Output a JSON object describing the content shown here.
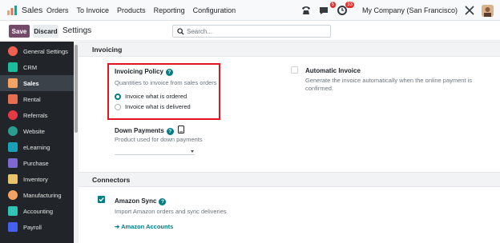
{
  "navbar": {
    "brand": "Sales",
    "menu": [
      "Orders",
      "To Invoice",
      "Products",
      "Reporting",
      "Configuration"
    ],
    "messages_badge": "5",
    "activity_badge": "33",
    "company": "My Company (San Francisco)"
  },
  "control_panel": {
    "save_label": "Save",
    "discard_label": "Discard",
    "title": "Settings",
    "search_placeholder": "Search..."
  },
  "sidebar": {
    "items": [
      {
        "label": "General Settings",
        "icon": "odoo-circle-icon",
        "color": "#f06050"
      },
      {
        "label": "CRM",
        "icon": "crm-icon",
        "color": "#1abc9c"
      },
      {
        "label": "Sales",
        "icon": "sales-icon",
        "color": "#f4a261",
        "active": true
      },
      {
        "label": "Rental",
        "icon": "rental-wrench-icon",
        "color": "#e76f51"
      },
      {
        "label": "Referrals",
        "icon": "referrals-icon",
        "color": "#e63946"
      },
      {
        "label": "Website",
        "icon": "website-icon",
        "color": "#2a9d8f"
      },
      {
        "label": "eLearning",
        "icon": "elearning-icon",
        "color": "#17a2b8"
      },
      {
        "label": "Purchase",
        "icon": "purchase-icon",
        "color": "#7c6ad1"
      },
      {
        "label": "Inventory",
        "icon": "inventory-icon",
        "color": "#e9c46a"
      },
      {
        "label": "Manufacturing",
        "icon": "manufacturing-icon",
        "color": "#f4a261"
      },
      {
        "label": "Accounting",
        "icon": "accounting-icon",
        "color": "#2ec4b6"
      },
      {
        "label": "Payroll",
        "icon": "payroll-icon",
        "color": "#4361ee"
      }
    ]
  },
  "invoicing": {
    "section_title": "Invoicing",
    "policy_title": "Invoicing Policy",
    "policy_desc": "Quantities to invoice from sales orders",
    "option_ordered": "Invoice what is ordered",
    "option_delivered": "Invoice what is delivered",
    "selected_option": "ordered",
    "auto_title": "Automatic Invoice",
    "auto_desc_1": "Generate the invoice automatically when the online payment is",
    "auto_desc_2": "confirmed.",
    "down_title": "Down Payments",
    "down_desc": "Product used for down payments"
  },
  "connectors": {
    "section_title": "Connectors",
    "amazon_title": "Amazon Sync",
    "amazon_desc": "Import Amazon orders and sync deliveries",
    "amazon_checked": true,
    "amazon_link": "Amazon Accounts"
  },
  "colors": {
    "primary": "#714b67",
    "accent": "#017e84",
    "highlight": "#e3131f"
  }
}
